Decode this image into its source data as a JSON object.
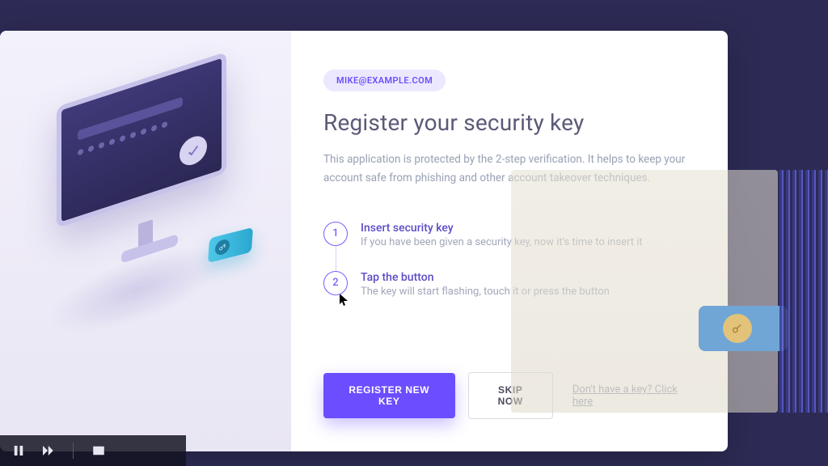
{
  "user": {
    "email": "MIKE@EXAMPLE.COM"
  },
  "header": {
    "title": "Register your security key",
    "description": "This application is protected by the 2-step verification. It helps to keep your account safe from phishing and other account takeover techniques."
  },
  "steps": [
    {
      "number": "1",
      "title": "Insert security key",
      "desc": "If you have been given a security key, now it's time to insert it"
    },
    {
      "number": "2",
      "title": "Tap the button",
      "desc": "The key will start flashing, touch it or press the button"
    }
  ],
  "actions": {
    "primary": "REGISTER NEW KEY",
    "secondary": "SKIP NOW",
    "help_link": "Don't have a key? Click here"
  },
  "colors": {
    "accent": "#6c4dff",
    "background": "#2d2b55"
  }
}
